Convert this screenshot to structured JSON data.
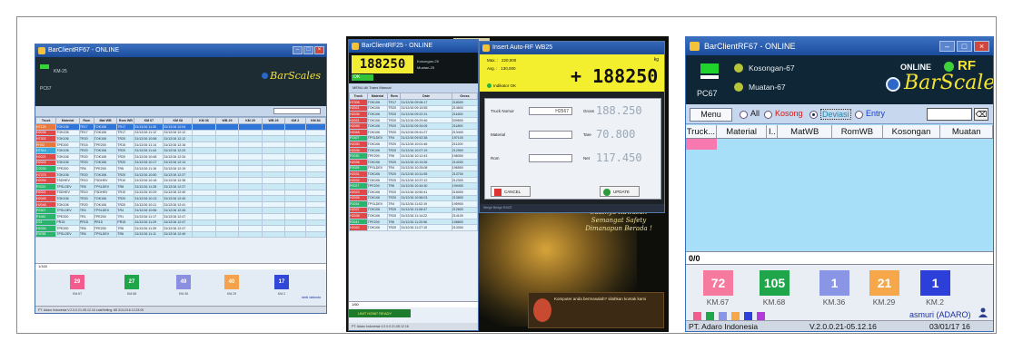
{
  "screen1": {
    "title": "BarClientRF67 - ONLINE",
    "pc": "PC67",
    "km": "KM-25",
    "logo": "BarScales",
    "columns": [
      "Truck",
      "Material",
      "Rom",
      "Mat WB",
      "Rom WB",
      "KM 67",
      "KM 68",
      "KM 36",
      "WB 29",
      "KM 29",
      "WB 29",
      "KM 2",
      "KM 84"
    ],
    "rows": [
      {
        "truck": "H7120",
        "material": "TOK106",
        "rom": "TR17",
        "matwb": "TOK106",
        "romwb": "TR17",
        "t1": "31/12/16 11:30",
        "t2": "31/12/16 12:04",
        "color": "#e9783a",
        "sel": true
      },
      {
        "truck": "H2036",
        "material": "TOK106",
        "rom": "TR17",
        "matwb": "TOK106",
        "romwb": "TR17",
        "t1": "31/12/16 11:12",
        "t2": "31/12/16 12:12",
        "color": "#e04848"
      },
      {
        "truck": "H7302",
        "material": "TOK106",
        "rom": "TR20",
        "matwb": "TOK106",
        "romwb": "TR20",
        "t1": "31/12/16 10:58",
        "t2": "31/12/16 12:12",
        "color": "#e04848"
      },
      {
        "truck": "PH02",
        "material": "TPE200",
        "rom": "TR15",
        "matwb": "TPE200",
        "romwb": "TR15",
        "t1": "31/12/16 11:14",
        "t2": "31/12/16 12:16",
        "color": "#e9783a"
      },
      {
        "truck": "H7314",
        "material": "TOK106",
        "rom": "TR20",
        "matwb": "TOK106",
        "romwb": "TR20",
        "t1": "31/12/16 11:44",
        "t2": "31/12/16 12:23",
        "color": "#3aa9d8"
      },
      {
        "truck": "H2021",
        "material": "TOK106",
        "rom": "TR20",
        "matwb": "TOK106",
        "romwb": "TR20",
        "t1": "31/12/16 10:48",
        "t2": "31/12/16 12:34",
        "color": "#e04848"
      },
      {
        "truck": "H2024",
        "material": "TOK106",
        "rom": "TR20",
        "matwb": "TOK106",
        "romwb": "TR20",
        "t1": "31/12/16 10:17",
        "t2": "31/12/16 12:14",
        "color": "#e04848"
      },
      {
        "truck": "C2030",
        "material": "TPE200",
        "rom": "TR6",
        "matwb": "TPE200",
        "romwb": "TR6",
        "t1": "31/12/16 11:16",
        "t2": "31/12/16 12:19",
        "color": "#2ab36a"
      },
      {
        "truck": "H7375",
        "material": "TOK106",
        "rom": "TR20",
        "matwb": "TOK106",
        "romwb": "TR20",
        "t1": "31/12/16 10:50",
        "t2": "31/12/16 12:37",
        "color": "#e04848"
      },
      {
        "truck": "H2094",
        "material": "TSDHEV",
        "rom": "TR10",
        "matwb": "TSDHEV",
        "romwb": "TR10",
        "t1": "31/12/16 10:18",
        "t2": "31/12/16 12:38",
        "color": "#e04848"
      },
      {
        "truck": "P2022",
        "material": "TPSLDEV",
        "rom": "TR8",
        "matwb": "TPSLDEV",
        "romwb": "TR8",
        "t1": "31/12/16 11:28",
        "t2": "31/12/16 12:37",
        "color": "#2ab36a"
      },
      {
        "truck": "H2021",
        "material": "TSDHEV",
        "rom": "TR10",
        "matwb": "TSDHEV",
        "romwb": "TR10",
        "t1": "31/12/16 10:29",
        "t2": "31/12/16 12:40",
        "color": "#e04848"
      },
      {
        "truck": "H2045",
        "material": "TOK106",
        "rom": "TR20",
        "matwb": "TOK106",
        "romwb": "TR20",
        "t1": "31/12/16 10:13",
        "t2": "31/12/16 12:40",
        "color": "#e04848"
      },
      {
        "truck": "H2048",
        "material": "TOK106",
        "rom": "TR20",
        "matwb": "TOK106",
        "romwb": "TR20",
        "t1": "31/12/16 10:11",
        "t2": "31/12/16 12:41",
        "color": "#e04848"
      },
      {
        "truck": "P2307",
        "material": "TPSLDEV",
        "rom": "TR4",
        "matwb": "TPSLDEV",
        "romwb": "TR4",
        "t1": "31/12/16 10:56",
        "t2": "31/12/16 12:45",
        "color": "#2ab36a"
      },
      {
        "truck": "P1062",
        "material": "TPE200",
        "rom": "TR1",
        "matwb": "TPE200",
        "romwb": "TR1",
        "t1": "31/12/16 11:17",
        "t2": "31/12/16 12:47",
        "color": "#2ab36a"
      },
      {
        "truck": "C01",
        "material": "PR15",
        "rom": "PR15",
        "matwb": "PR15",
        "romwb": "PR15",
        "t1": "31/12/16 11:29",
        "t2": "31/12/16 12:47",
        "color": "#2ab36a"
      },
      {
        "truck": "H2030",
        "material": "TPE200",
        "rom": "TR6",
        "matwb": "TPE200",
        "romwb": "TR6",
        "t1": "31/12/16 11:39",
        "t2": "31/12/16 12:47",
        "color": "#2ab36a"
      },
      {
        "truck": "P2035",
        "material": "TPSLDEV",
        "rom": "TR6",
        "matwb": "TPSLDEV",
        "romwb": "TR6",
        "t1": "31/12/16 11:11",
        "t2": "31/12/16 12:49",
        "color": "#2ab36a"
      }
    ],
    "count": "1/160",
    "tiles": [
      {
        "value": "29",
        "label": "KM.67",
        "color": "#f25d8e"
      },
      {
        "value": "27",
        "label": "KM.68",
        "color": "#1fa64a"
      },
      {
        "value": "49",
        "label": "KM.36",
        "color": "#8a8fe0"
      },
      {
        "value": "40",
        "label": "KM.29",
        "color": "#f5a24a"
      },
      {
        "value": "17",
        "label": "KM.2",
        "color": "#3147d8"
      }
    ],
    "user": "sinti widodo",
    "status": "PT. Adaro Indonesia   V.2.0.0.21-05.12.16        LastSetting: 88        31/12/16 12:23:00"
  },
  "screen2": {
    "title": "BarClientRF25 - ONLINE",
    "lcd": "188250",
    "ok": "OK",
    "sub": [
      "Kosongan-25",
      "Muatan-25"
    ],
    "menu": "MENU   All Trans   Manual",
    "rows": [
      {
        "truck": "H7306",
        "material": "TOK106",
        "rom": "TR17",
        "date": "31/12/16 09:06:17",
        "gross": "218000",
        "color": "#e04848"
      },
      {
        "truck": "H2021",
        "material": "TOK106",
        "rom": "TR20",
        "date": "31/12/16 09:15:55",
        "gross": "214600",
        "color": "#e04848"
      },
      {
        "truck": "H2035",
        "material": "TOK106",
        "rom": "TR20",
        "date": "31/12/16 09:22:31",
        "gross": "211600",
        "color": "#e04848"
      },
      {
        "truck": "H2021",
        "material": "TOK106",
        "rom": "TR20",
        "date": "31/12/16 09:29:46",
        "gross": "209500",
        "color": "#e04848"
      },
      {
        "truck": "H2045",
        "material": "TOK106",
        "rom": "TR20",
        "date": "31/12/16 09:34:05",
        "gross": "211800",
        "color": "#e04848"
      },
      {
        "truck": "H2048",
        "material": "TOK106",
        "rom": "TR20",
        "date": "31/12/16 09:41:27",
        "gross": "213400",
        "color": "#e04848"
      },
      {
        "truck": "P2307",
        "material": "TPSLDEV",
        "rom": "TR4",
        "date": "31/12/16 09:52:38",
        "gross": "197100",
        "color": "#2ab36a"
      },
      {
        "truck": "H2030",
        "material": "TOK106",
        "rom": "TR20",
        "date": "31/12/16 10:01:46",
        "gross": "211200",
        "color": "#e04848"
      },
      {
        "truck": "H2036",
        "material": "TOK106",
        "rom": "TR20",
        "date": "31/12/16 10:07:19",
        "gross": "212900",
        "color": "#e04848"
      },
      {
        "truck": "P2030",
        "material": "TPE200",
        "rom": "TR6",
        "date": "31/12/16 10:12:43",
        "gross": "198300",
        "color": "#2ab36a"
      },
      {
        "truck": "H2036",
        "material": "TOK106",
        "rom": "TR20",
        "date": "31/12/16 10:19:26",
        "gross": "214200",
        "color": "#e04848"
      },
      {
        "truck": "P2029",
        "material": "TPSLDEV",
        "rom": "TR4",
        "date": "31/12/16 10:25:08",
        "gross": "196500",
        "color": "#2ab36a"
      },
      {
        "truck": "H2031",
        "material": "TOK106",
        "rom": "TR20",
        "date": "31/12/16 10:31:55",
        "gross": "213700",
        "color": "#e04848"
      },
      {
        "truck": "H2032",
        "material": "TOK106",
        "rom": "TR20",
        "date": "31/12/16 10:37:12",
        "gross": "212300",
        "color": "#e04848"
      },
      {
        "truck": "P2027",
        "material": "TPE200",
        "rom": "TR6",
        "date": "31/12/16 10:44:30",
        "gross": "199400",
        "color": "#2ab36a"
      },
      {
        "truck": "H2023",
        "material": "TOK106",
        "rom": "TR20",
        "date": "31/12/16 10:50:41",
        "gross": "215000",
        "color": "#e04848"
      },
      {
        "truck": "H2026",
        "material": "TOK106",
        "rom": "TR20",
        "date": "31/12/16 10:56:03",
        "gross": "213800",
        "color": "#e04848"
      },
      {
        "truck": "P2034",
        "material": "TPSLDEV",
        "rom": "TR4",
        "date": "31/12/16 11:02:19",
        "gross": "195900",
        "color": "#2ab36a"
      },
      {
        "truck": "H2037",
        "material": "TOK106",
        "rom": "TR20",
        "date": "31/12/16 11:08:47",
        "gross": "212600",
        "color": "#e04848"
      },
      {
        "truck": "H2038",
        "material": "TOK106",
        "rom": "TR20",
        "date": "31/12/16 11:14:22",
        "gross": "214100",
        "color": "#e04848"
      },
      {
        "truck": "P2041",
        "material": "TPE200",
        "rom": "TR6",
        "date": "31/12/16 11:20:56",
        "gross": "198800",
        "color": "#2ab36a"
      },
      {
        "truck": "H2042",
        "material": "TOK106",
        "rom": "TR20",
        "date": "31/12/16 11:27:10",
        "gross": "213300",
        "color": "#e04848"
      }
    ],
    "count": "1/60",
    "ready": "UNIT H2567 READY",
    "status": "PT. Adaro Indonesia   V.2.0.0.21-05.12.16"
  },
  "dialog": {
    "title": "Insert Auto-RF WB25",
    "max_label": "Max. :",
    "max_value": "220,000",
    "avg_label": "Avg. :",
    "avg_value": "130,000",
    "unit": "kg",
    "big_value": "188250",
    "indicator": "Indikator OK",
    "truck_label": "Truck Nomor",
    "truck_value": "H2567",
    "material_label": "Material",
    "rom_label": "Rom",
    "gross_label": "Gross",
    "gross_value": "188.250",
    "tare_label": "Tare",
    "tare_value": "70.800",
    "net_label": "Net",
    "net_value": "117.450",
    "cancel": "CANCEL",
    "update": "UPDATE",
    "footer": "Weigh Bridge RACE"
  },
  "background": {
    "phone_text": "Hub Kantor",
    "slogan": "Saatnya Kawasan Semangat Safety Dimanapun Berada !",
    "news": "Komputer anda bermasalah? silahkan kontak kami"
  },
  "screen3": {
    "title": "BarClientRF67 - ONLINE",
    "pc": "PC67",
    "kosongan": "Kosongan-67",
    "muatan": "Muatan-67",
    "online": "ONLINE",
    "rf": "RF",
    "logo": "BarScales",
    "menu": "Menu",
    "radio_all": "All",
    "radio_kosong": "Kosong",
    "radio_deviasi": "Deviasi",
    "radio_entry": "Entry",
    "clear_symbol": "⌫",
    "columns": [
      "Truck...",
      "Material",
      "I..",
      "MatWB",
      "RomWB",
      "Kosongan",
      "Muatan"
    ],
    "count": "0/0",
    "tiles": [
      {
        "value": "72",
        "label": "KM.67",
        "color": "#f57a9e"
      },
      {
        "value": "105",
        "label": "KM.68",
        "color": "#1fa64a"
      },
      {
        "value": "1",
        "label": "KM.36",
        "color": "#8b95e6"
      },
      {
        "value": "21",
        "label": "KM.29",
        "color": "#f5a74a"
      },
      {
        "value": "1",
        "label": "KM.2",
        "color": "#2c3fd8"
      }
    ],
    "user": "asmuri (ADARO)",
    "status_company": "PT. Adaro Indonesia",
    "status_version": "V.2.0.0.21-05.12.16",
    "status_date": "03/01/17 16",
    "swatch_colors": [
      "#f25d8e",
      "#1fa64a",
      "#8b95e6",
      "#f5a74a",
      "#2c3fd8",
      "#b13ad8"
    ]
  }
}
